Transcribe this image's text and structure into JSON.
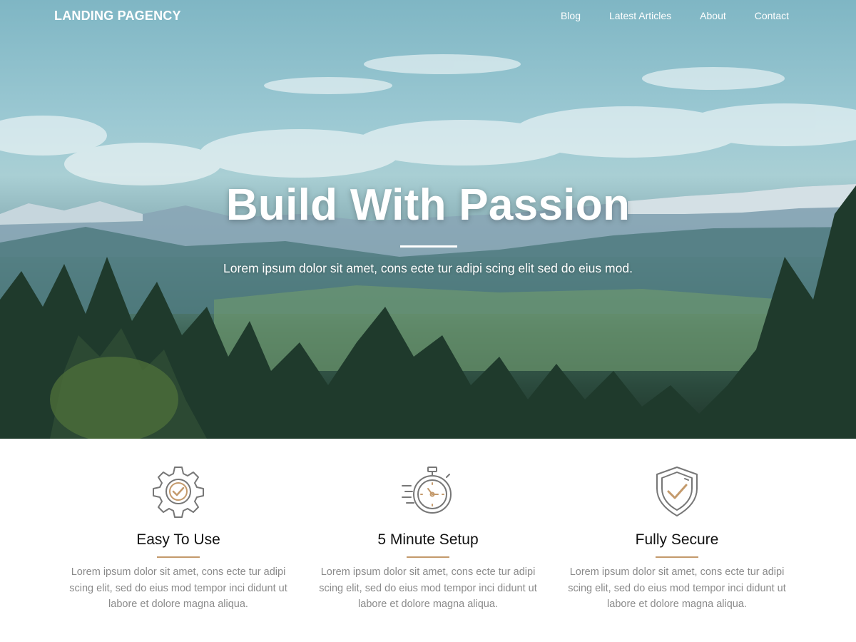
{
  "nav": {
    "brand": "LANDING PAGENCY",
    "links": [
      "Blog",
      "Latest Articles",
      "About",
      "Contact"
    ]
  },
  "hero": {
    "title": "Build With Passion",
    "subtitle": "Lorem ipsum dolor sit amet, cons ecte tur adipi scing elit sed do eius mod."
  },
  "features": [
    {
      "icon": "gear-check-icon",
      "title": "Easy To Use",
      "text": "Lorem ipsum dolor sit amet, cons ecte tur adipi scing elit, sed do eius mod tempor inci didunt ut labore et dolore magna aliqua."
    },
    {
      "icon": "stopwatch-icon",
      "title": "5 Minute Setup",
      "text": "Lorem ipsum dolor sit amet, cons ecte tur adipi scing elit, sed do eius mod tempor inci didunt ut labore et dolore magna aliqua."
    },
    {
      "icon": "shield-check-icon",
      "title": "Fully Secure",
      "text": "Lorem ipsum dolor sit amet, cons ecte tur adipi scing elit, sed do eius mod tempor inci didunt ut labore et dolore magna aliqua."
    }
  ],
  "colors": {
    "accent": "#c49a6c",
    "icon_stroke": "#777777",
    "body_text": "#8a8a8a"
  }
}
